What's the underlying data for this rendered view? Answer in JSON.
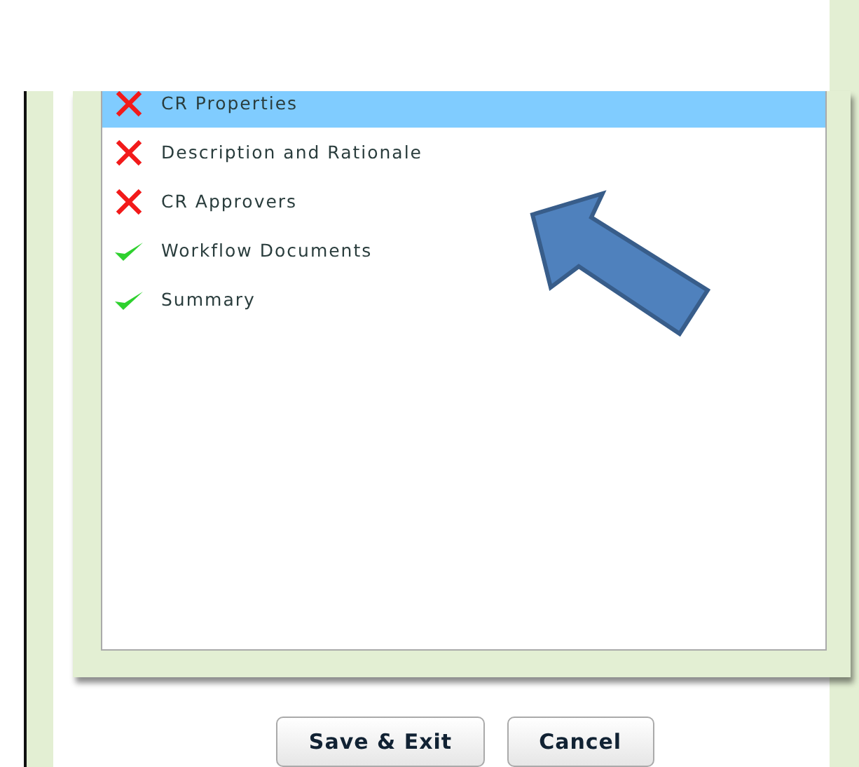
{
  "steps": [
    {
      "label": "CR Properties",
      "kind": "cross",
      "selected": true
    },
    {
      "label": "Description and Rationale",
      "kind": "cross",
      "selected": false
    },
    {
      "label": "CR Approvers",
      "kind": "cross",
      "selected": false
    },
    {
      "label": "Workflow Documents",
      "kind": "check",
      "selected": false
    },
    {
      "label": "Summary",
      "kind": "check",
      "selected": false
    }
  ],
  "buttons": [
    "Save & Exit",
    "Cancel"
  ]
}
